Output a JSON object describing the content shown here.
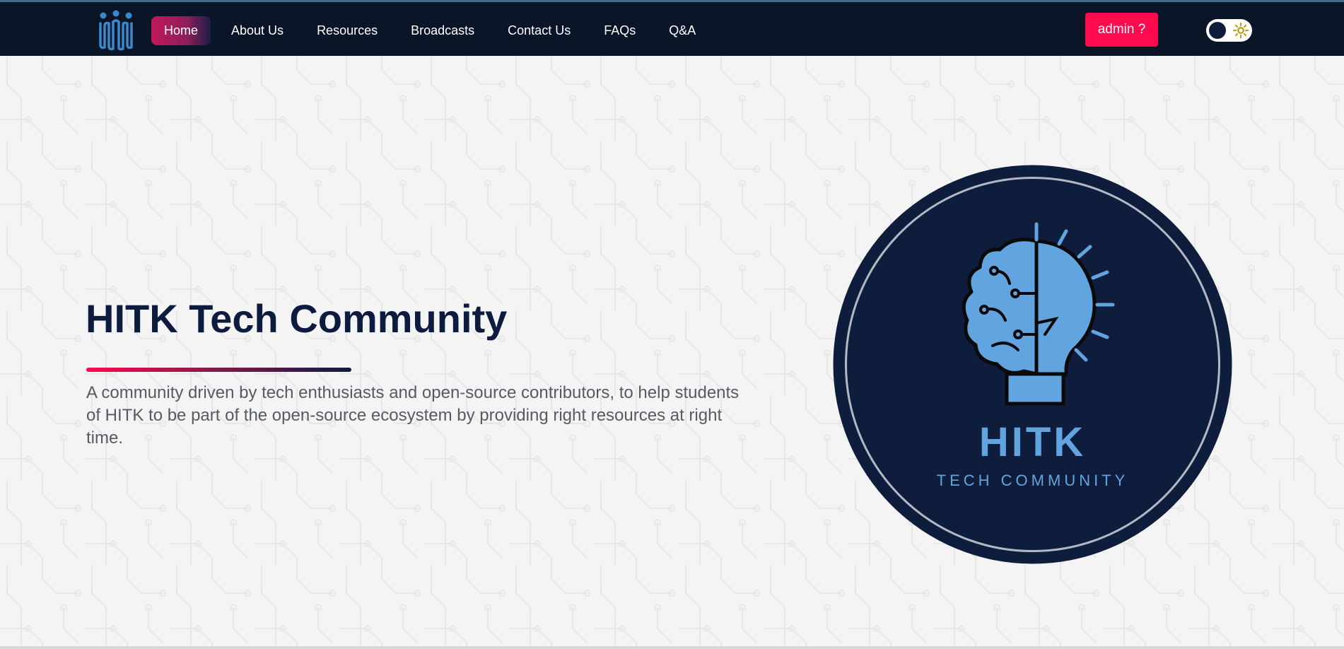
{
  "nav": {
    "items": [
      {
        "label": "Home",
        "active": true
      },
      {
        "label": "About Us"
      },
      {
        "label": "Resources"
      },
      {
        "label": "Broadcasts"
      },
      {
        "label": "Contact Us"
      },
      {
        "label": "FAQs"
      },
      {
        "label": "Q&A"
      }
    ],
    "admin_label": "admin ?"
  },
  "hero": {
    "title": "HITK Tech Community",
    "description": "A community driven by tech enthusiasts and open-source contributors, to help students of HITK to be part of the open-source ecosystem by providing right resources at right time."
  },
  "badge": {
    "title": "HITK",
    "subtitle": "TECH COMMUNITY"
  },
  "colors": {
    "navbar": "#0a1628",
    "accent": "#ff0a4f",
    "navy": "#0d1b3e",
    "logo_blue": "#5b9bd5"
  },
  "icons": [
    "community-logo-icon",
    "sun-icon",
    "brain-bulb-icon"
  ]
}
